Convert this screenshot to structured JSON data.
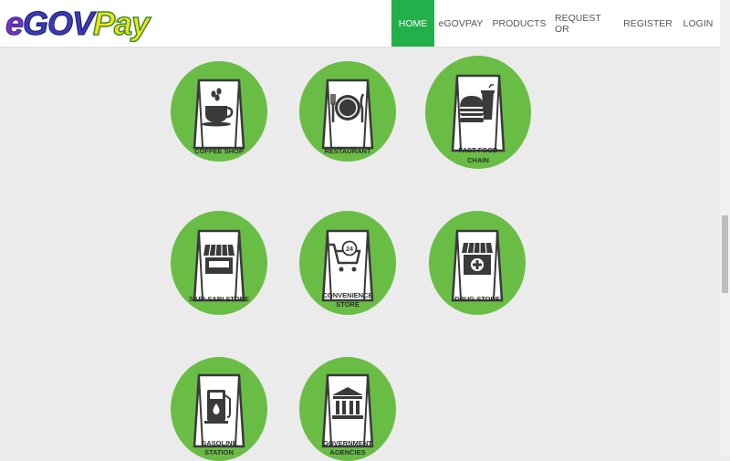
{
  "brand": {
    "e": "e",
    "gov": "GOV",
    "pay": "Pay"
  },
  "nav": {
    "home": "HOME",
    "egovpay": "eGOVPAY",
    "products": "PRODUCTS",
    "request": "REQUEST OR",
    "register": "REGISTER",
    "login": "LOGIN"
  },
  "categories": {
    "coffee": "COFFEE SHOP",
    "restaurant": "RESTAURANT",
    "fastfood_1": "FAST FOOD",
    "fastfood_2": "CHAIN",
    "sari": "SARI-SARI STORE",
    "convenience_1": "CONVENIENCE",
    "convenience_2": "STORE",
    "drug": "DRUG STORE",
    "gasoline_1": "GASOLINE",
    "gasoline_2": "STATION",
    "government_1": "GOVERNMENT",
    "government_2": "AGENCIES",
    "badge_24": "24"
  },
  "colors": {
    "nav_active": "#22b04a",
    "tile_green": "#69bd45",
    "icon_dark": "#3a3a3a"
  }
}
